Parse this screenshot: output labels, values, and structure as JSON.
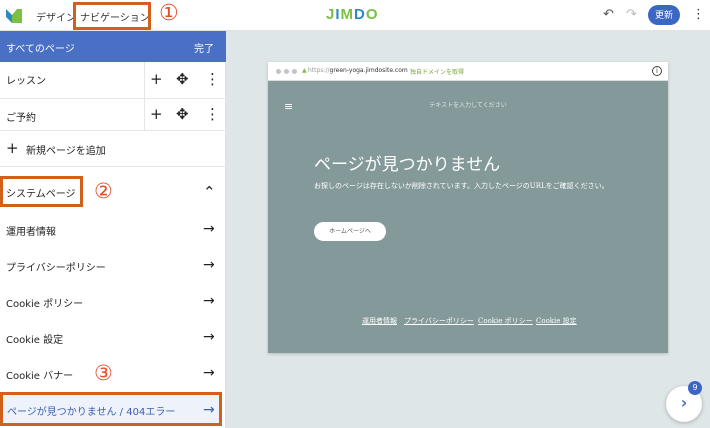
{
  "topbar": {
    "tab_design": "デザイン",
    "tab_navigation": "ナビゲーション",
    "annotation_1": "①",
    "brand": "JIMDO",
    "undo_icon": "↶",
    "redo_icon": "↷",
    "update_label": "更新",
    "more_icon": "⋮"
  },
  "sidebar": {
    "header_title": "すべてのページ",
    "header_done": "完了",
    "pages": [
      {
        "label": "レッスン"
      },
      {
        "label": "ご予約"
      }
    ],
    "add_page": "新規ページを追加",
    "system_title": "システムページ",
    "annotation_2": "②",
    "system_items": [
      {
        "label": "運用者情報"
      },
      {
        "label": "プライバシーポリシー"
      },
      {
        "label": "Cookie ポリシー"
      },
      {
        "label": "Cookie 設定"
      },
      {
        "label": "Cookie バナー"
      }
    ],
    "annotation_3": "③",
    "active_item": "ページが見つかりません / 404エラー"
  },
  "preview": {
    "url_scheme": "https://",
    "url_domain": "green-yoga.jimdosite.com",
    "domain_link": "独自ドメインを取得",
    "info_icon": "i",
    "placeholder": "テキストを入力してください",
    "title": "ページが見つかりません",
    "description": "お探しのページは存在しないか削除されています。入力したページのURLをご確認ください。",
    "home_button": "ホームページへ",
    "footer_links": [
      "運用者情報",
      "プライバシーポリシー",
      "Cookie ポリシー",
      "Cookie 設定"
    ]
  },
  "help": {
    "badge": "9",
    "icon": "›"
  },
  "colors": {
    "accent": "#4a70c6",
    "highlight": "#d0611c",
    "annotation": "#e0502a",
    "preview_bg": "#84999a"
  }
}
